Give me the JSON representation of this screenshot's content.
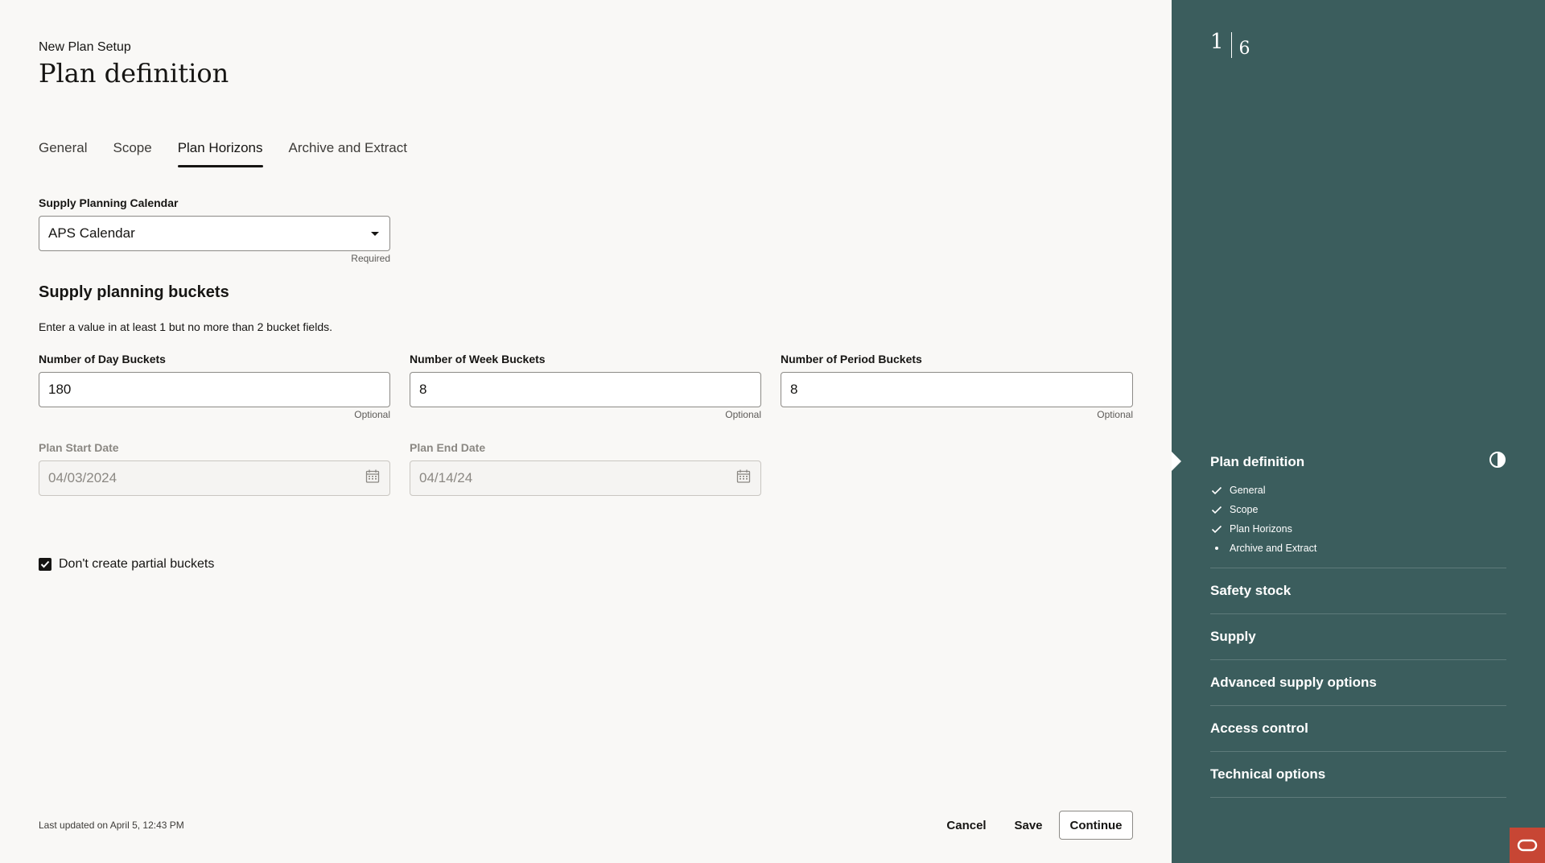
{
  "header": {
    "overline": "New Plan Setup",
    "title": "Plan definition"
  },
  "tabs": [
    {
      "label": "General"
    },
    {
      "label": "Scope"
    },
    {
      "label": "Plan Horizons",
      "active": true
    },
    {
      "label": "Archive and Extract"
    }
  ],
  "calendar": {
    "label": "Supply Planning Calendar",
    "value": "APS Calendar",
    "hint": "Required"
  },
  "buckets": {
    "title": "Supply planning buckets",
    "instruction": "Enter a value in at least 1 but no more than 2 bucket fields.",
    "day": {
      "label": "Number of Day Buckets",
      "value": "180",
      "hint": "Optional"
    },
    "week": {
      "label": "Number of Week Buckets",
      "value": "8",
      "hint": "Optional"
    },
    "period": {
      "label": "Number of Period Buckets",
      "value": "8",
      "hint": "Optional"
    }
  },
  "dates": {
    "start": {
      "label": "Plan Start Date",
      "value": "04/03/2024"
    },
    "end": {
      "label": "Plan End Date",
      "value": "04/14/24"
    }
  },
  "partial": {
    "label": "Don't create partial buckets",
    "checked": true
  },
  "footer": {
    "last_updated": "Last updated on April 5, 12:43 PM",
    "cancel": "Cancel",
    "save": "Save",
    "continue": "Continue"
  },
  "sidebar": {
    "current_step": "1",
    "total_steps": "6",
    "active_step": {
      "label": "Plan definition",
      "substeps": [
        {
          "label": "General",
          "status": "done"
        },
        {
          "label": "Scope",
          "status": "done"
        },
        {
          "label": "Plan Horizons",
          "status": "done"
        },
        {
          "label": "Archive and Extract",
          "status": "current"
        }
      ]
    },
    "steps": [
      {
        "label": "Safety stock"
      },
      {
        "label": "Supply"
      },
      {
        "label": "Advanced supply options"
      },
      {
        "label": "Access control"
      },
      {
        "label": "Technical options"
      }
    ]
  },
  "colors": {
    "sidebar_bg": "#3b5d5d",
    "page_bg": "#f9f8f6",
    "help_badge": "#c74634"
  },
  "icons": {
    "calendar": "calendar-icon",
    "dropdown": "caret-down-icon",
    "check": "check-icon",
    "progress": "half-circle-icon",
    "help": "oracle-help-icon"
  }
}
